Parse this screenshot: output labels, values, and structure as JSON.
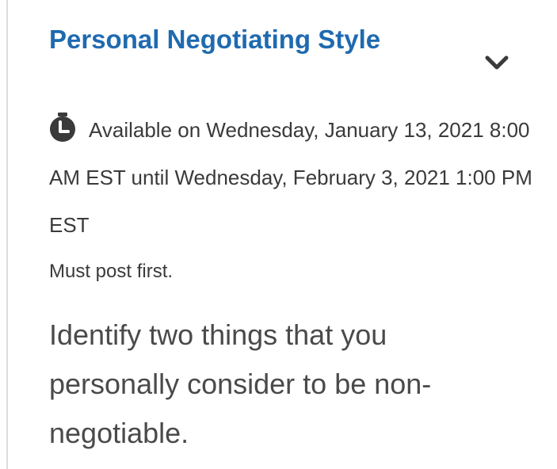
{
  "topic": {
    "title": "Personal Negotiating Style",
    "toggle_icon": "chevron-down-icon",
    "availability_icon": "clock-icon",
    "availability": "Available on Wednesday, January 13, 2021 8:00 AM EST until Wednesday, February 3, 2021 1:00 PM EST",
    "requirement": "Must post first.",
    "description": "Identify two things that you personally consider to be non-negotiable."
  },
  "colors": {
    "title": "#1f6ab0",
    "icon": "#3a3a3a",
    "body_text": "#3a3a3a",
    "divider": "#dcdcdc"
  }
}
